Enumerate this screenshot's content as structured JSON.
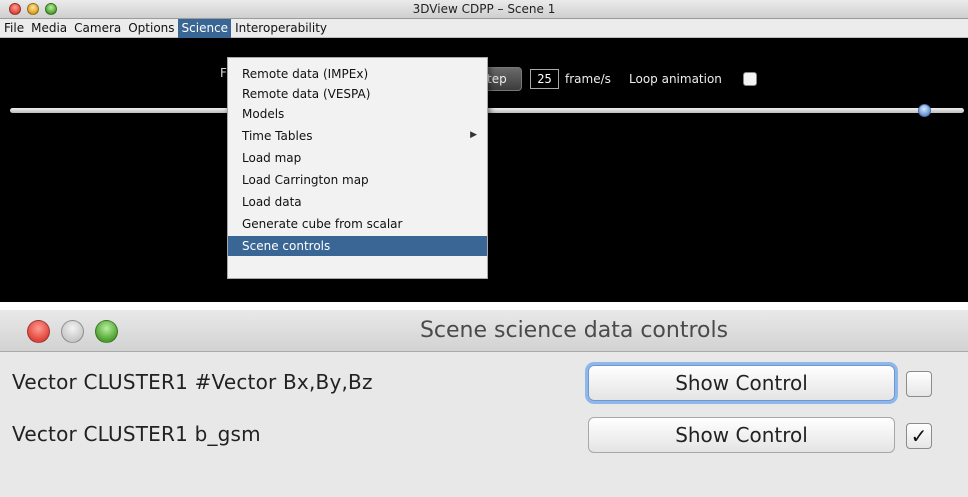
{
  "top_window": {
    "title": "3DView CDPP – Scene 1",
    "menus": [
      "File",
      "Media",
      "Camera",
      "Options",
      "Science",
      "Interoperability"
    ],
    "active_menu": "Science",
    "controls": {
      "partial_label": "F",
      "step_label": "tep",
      "fps_value": "25",
      "fps_unit": "frame/s",
      "loop_label": "Loop animation",
      "loop_checked": false
    },
    "science_menu": {
      "items": [
        "Remote data (IMPEx)",
        "Remote data (VESPA)",
        "Models",
        "Time Tables",
        "Load map",
        "Load Carrington map",
        "Load data",
        "Generate cube from scalar",
        "Scene controls"
      ],
      "submenu_item": "Time Tables",
      "selected": "Scene controls"
    }
  },
  "bottom_window": {
    "title": "Scene science data controls",
    "rows": [
      {
        "label": "Vector CLUSTER1  #Vector Bx,By,Bz",
        "button": "Show Control",
        "checked": false,
        "checkbox_text": ""
      },
      {
        "label": "Vector CLUSTER1 b_gsm",
        "button": "Show Control",
        "checked": true,
        "checkbox_text": "✓"
      }
    ]
  },
  "colors": {
    "selection_blue": "#3a6695",
    "canvas_black": "#000000",
    "focus_ring": "#8fb7ea"
  }
}
